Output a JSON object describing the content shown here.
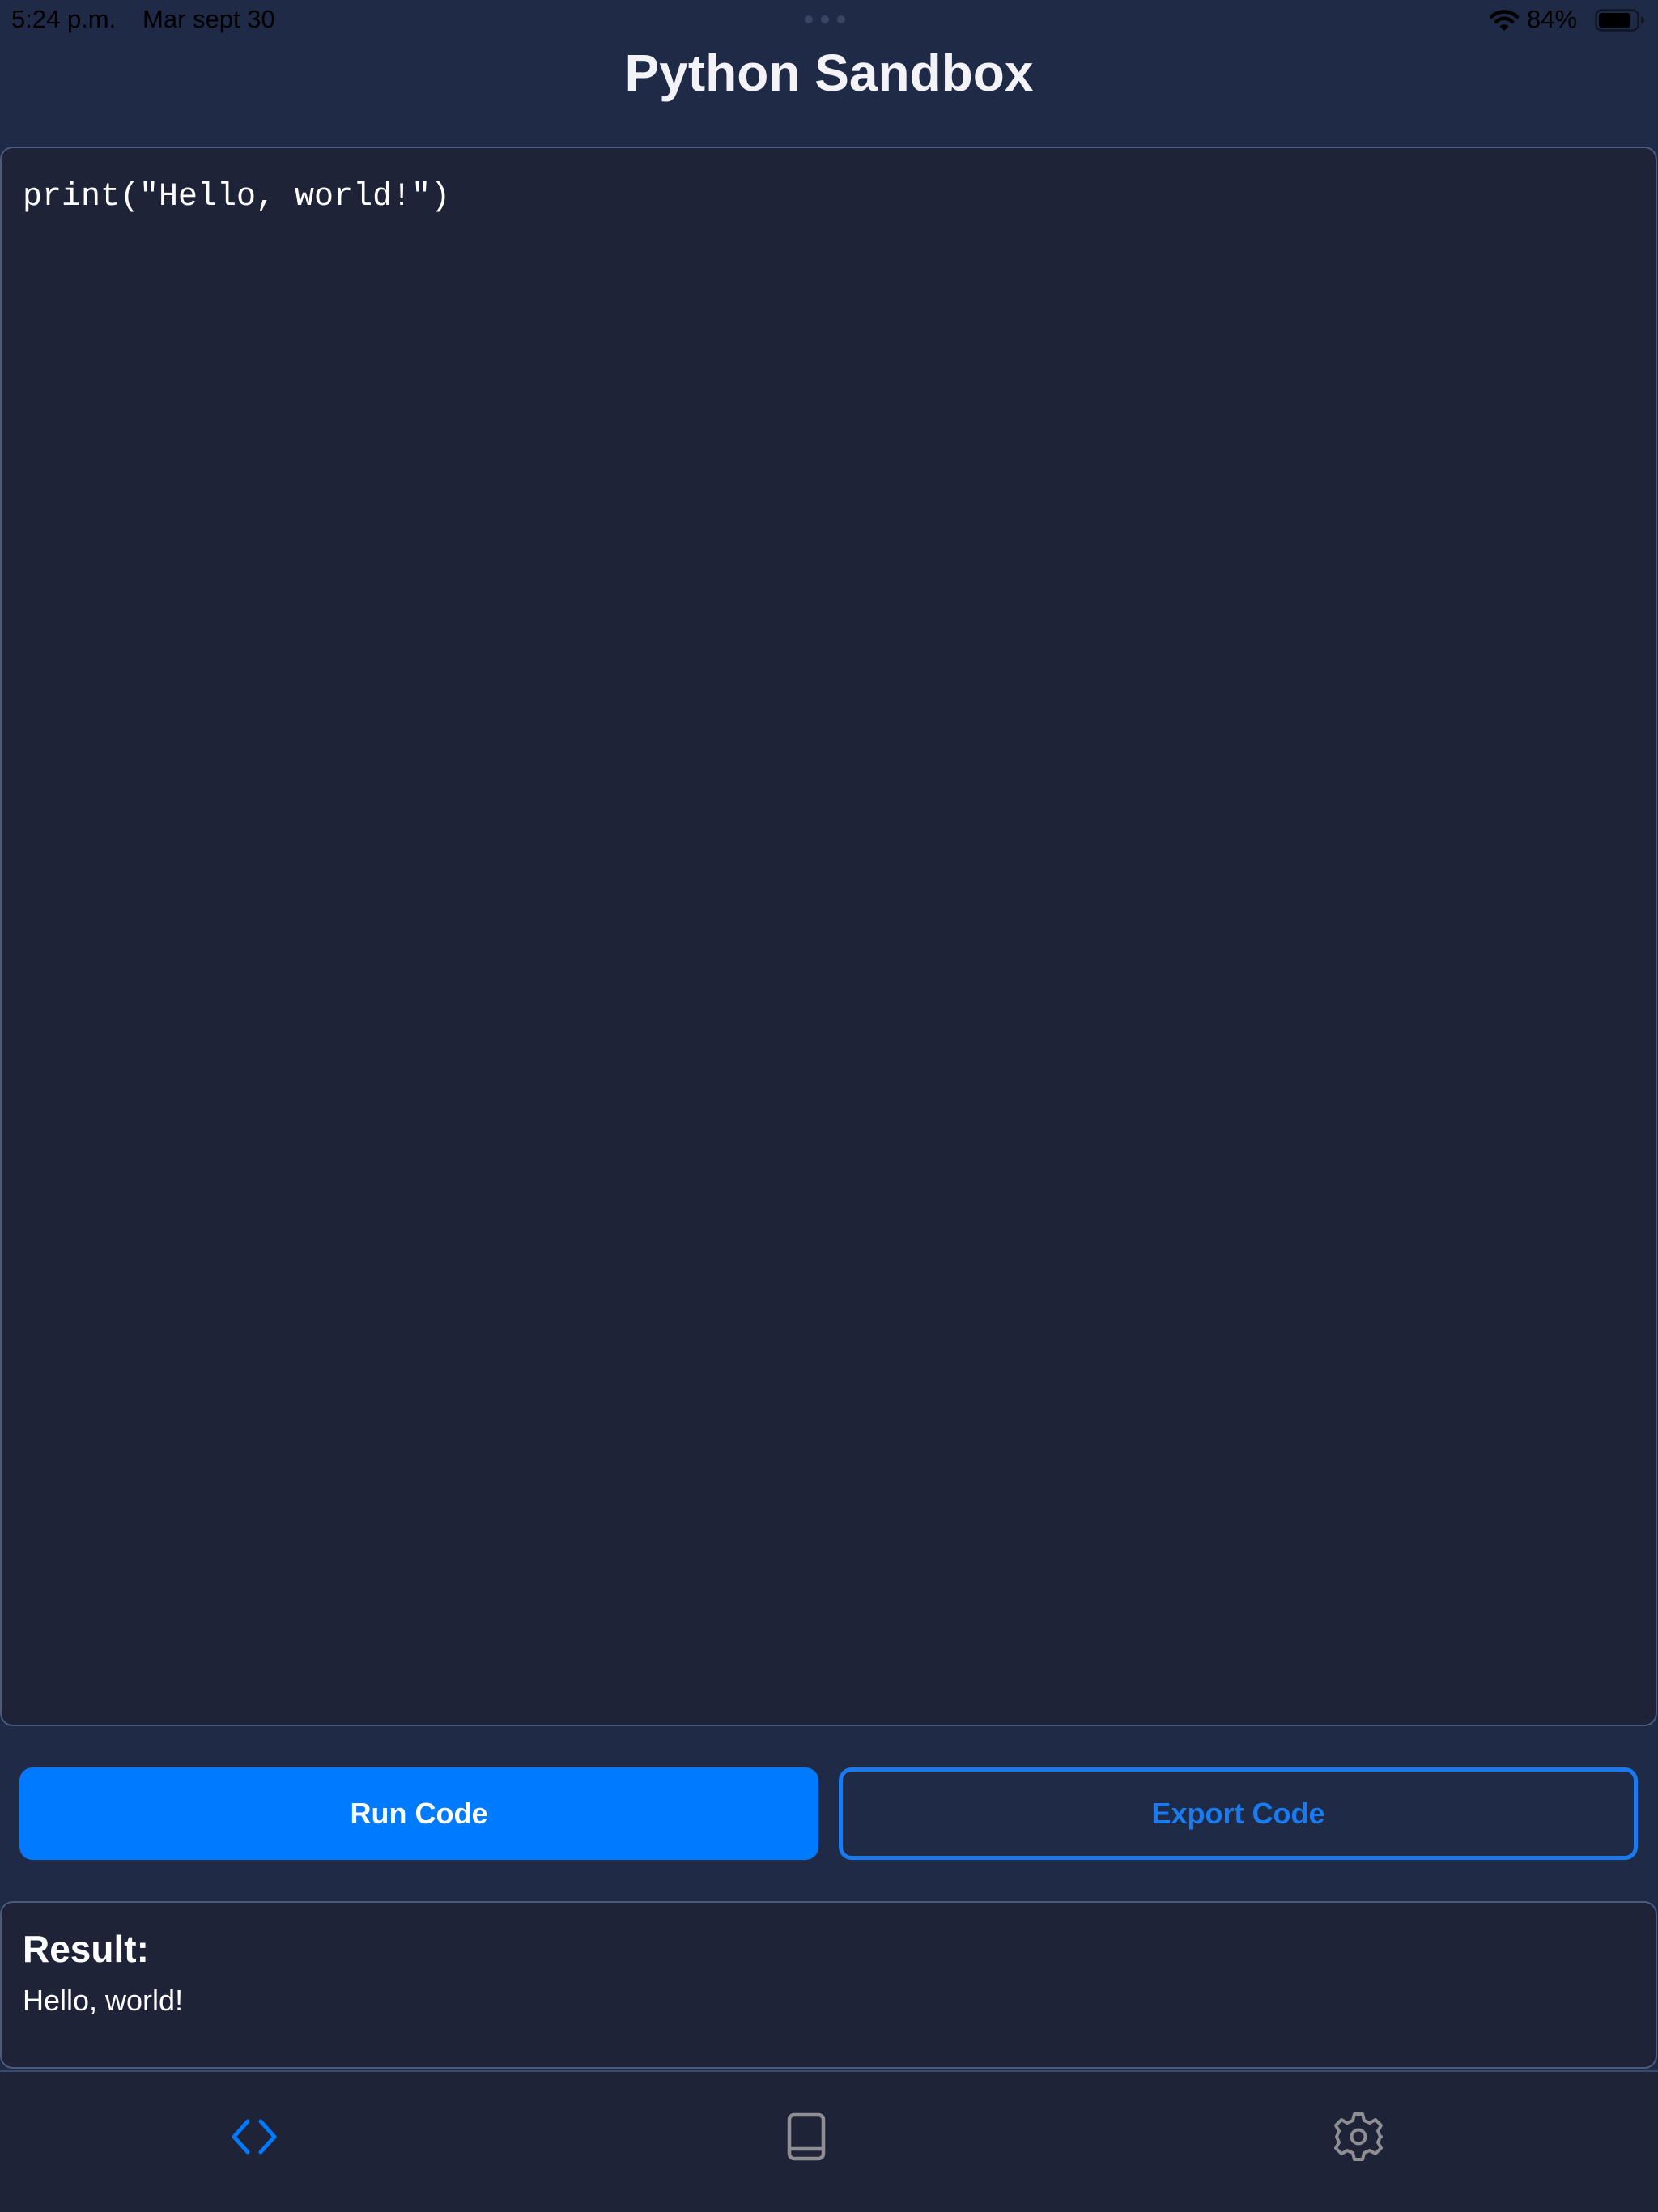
{
  "status_bar": {
    "time": "5:24 p.m.",
    "date": "Mar sept 30",
    "battery": "84%"
  },
  "nav": {
    "title": "Python Sandbox"
  },
  "editor": {
    "code": "print(\"Hello, world!\")"
  },
  "actions": {
    "run_label": "Run Code",
    "export_label": "Export Code"
  },
  "result": {
    "title": "Result:",
    "output": "Hello, world!"
  },
  "tab_bar": {
    "items": [
      {
        "icon": "code-brackets-icon",
        "selected": true
      },
      {
        "icon": "book-icon",
        "selected": false
      },
      {
        "icon": "gear-icon",
        "selected": false
      }
    ]
  },
  "colors": {
    "background": "#1f2a47",
    "panel": "#1e2338",
    "accent": "#007aff",
    "inactive_icon": "#8e8e93"
  }
}
